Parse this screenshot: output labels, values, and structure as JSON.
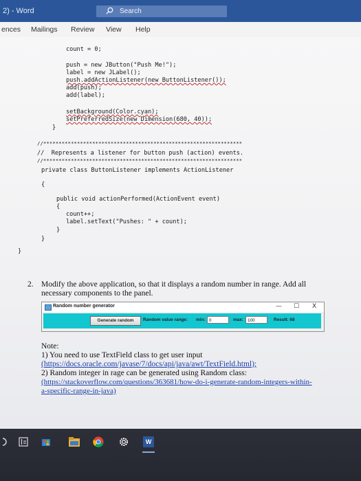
{
  "window": {
    "title": "2) - Word",
    "search_label": "Search"
  },
  "ribbon": {
    "tabs": [
      "ences",
      "Mailings",
      "Review",
      "View",
      "Help"
    ]
  },
  "code_block_1": [
    "count = 0;",
    "",
    "push = new JButton(\"Push Me!\");",
    "label = new JLabel();",
    "push.addActionListener(new ButtonListener());",
    "add(push);",
    "add(label);",
    "",
    "setBackground(Color.cyan);",
    "setPreferredSize(new Dimension(680, 40));",
    "}"
  ],
  "code_block_2": [
    "//*****************************************************************",
    "//  Represents a listener for button push (action) events.",
    "//*****************************************************************",
    "private class ButtonListener implements ActionListener",
    "{",
    "public void actionPerformed(ActionEvent event)",
    "{",
    "count++;",
    "label.setText(\"Pushes: \" + count);",
    "}",
    "}",
    "}"
  ],
  "question": {
    "number": "2.",
    "line1": "Modify the above application, so that it displays a random number in range. Add all",
    "line2": "necessary components to the panel."
  },
  "java_window": {
    "title": "Random number generator",
    "min_btn": "—",
    "max_btn": "☐",
    "close_btn": "X",
    "button_label": "Generate random",
    "range_label": "Random value range:",
    "min_label": "min:",
    "min_value": "0",
    "max_label": "max:",
    "max_value": "100",
    "result_label": "Result: 68",
    "bg_color": "#14c6cf"
  },
  "note": {
    "heading": "Note:",
    "line1": "1) You need to use TextField class to get user input",
    "link1": "(https://docs.oracle.com/javase/7/docs/api/java/awt/TextField.html);",
    "line2": "2) Random integer in rage can be generated using Random class:",
    "link2a": "(https://stackoverflow.com/questions/363681/how-do-i-generate-random-integers-within-",
    "link2b": "a-specific-range-in-java)"
  },
  "taskbar": {
    "icons": [
      "back-icon",
      "task-view-icon",
      "store-icon",
      "file-explorer-icon",
      "chrome-icon",
      "settings-icon",
      "word-icon"
    ],
    "word_glyph": "W"
  }
}
